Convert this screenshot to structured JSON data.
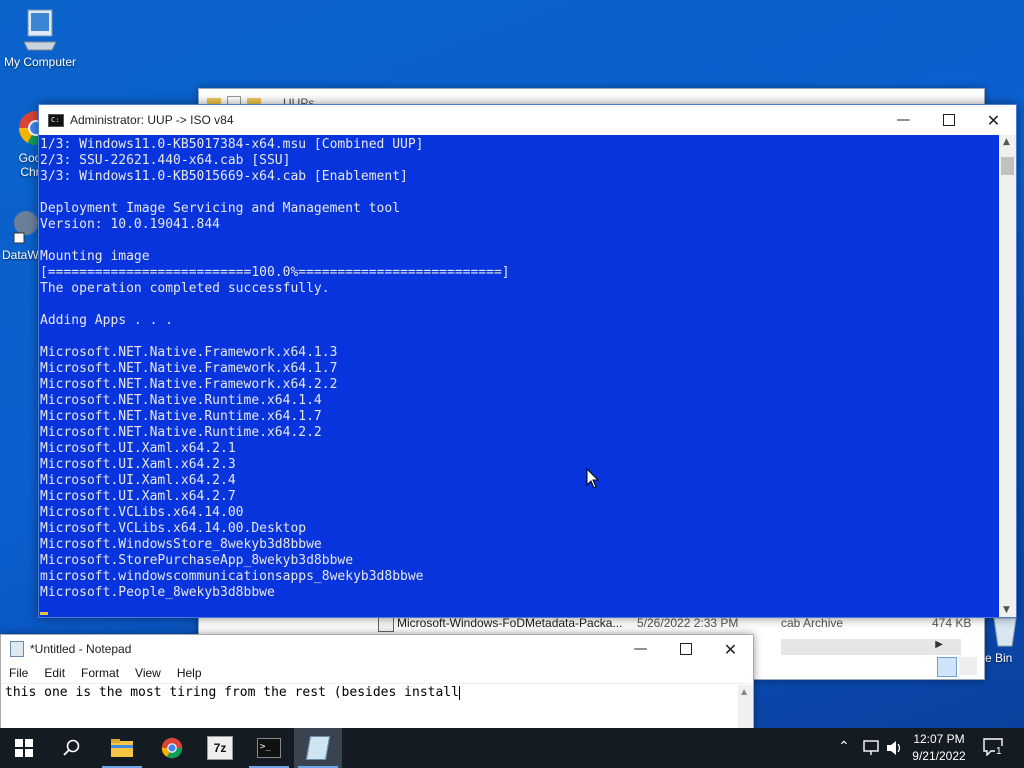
{
  "desktop": {
    "icons": [
      {
        "label": "My Computer"
      },
      {
        "label": "Goo\nChr"
      },
      {
        "label": "DataW"
      },
      {
        "label": "e Bin"
      }
    ]
  },
  "explorer": {
    "title": "UUPs",
    "file": {
      "name": "Microsoft-Windows-FoDMetadata-Packa...",
      "date": "5/26/2022 2:33 PM",
      "type": "cab Archive",
      "size": "474 KB"
    }
  },
  "cmd": {
    "title": "Administrator:  UUP -> ISO v84",
    "lines": [
      "1/3: Windows11.0-KB5017384-x64.msu [Combined UUP]",
      "2/3: SSU-22621.440-x64.cab [SSU]",
      "3/3: Windows11.0-KB5015669-x64.cab [Enablement]",
      "",
      "Deployment Image Servicing and Management tool",
      "Version: 10.0.19041.844",
      "",
      "Mounting image",
      "[==========================100.0%==========================]",
      "The operation completed successfully.",
      "",
      "Adding Apps . . .",
      "",
      "Microsoft.NET.Native.Framework.x64.1.3",
      "Microsoft.NET.Native.Framework.x64.1.7",
      "Microsoft.NET.Native.Framework.x64.2.2",
      "Microsoft.NET.Native.Runtime.x64.1.4",
      "Microsoft.NET.Native.Runtime.x64.1.7",
      "Microsoft.NET.Native.Runtime.x64.2.2",
      "Microsoft.UI.Xaml.x64.2.1",
      "Microsoft.UI.Xaml.x64.2.3",
      "Microsoft.UI.Xaml.x64.2.4",
      "Microsoft.UI.Xaml.x64.2.7",
      "Microsoft.VCLibs.x64.14.00",
      "Microsoft.VCLibs.x64.14.00.Desktop",
      "Microsoft.WindowsStore_8wekyb3d8bbwe",
      "Microsoft.StorePurchaseApp_8wekyb3d8bbwe",
      "microsoft.windowscommunicationsapps_8wekyb3d8bbwe",
      "Microsoft.People_8wekyb3d8bbwe"
    ]
  },
  "notepad": {
    "title": "*Untitled - Notepad",
    "menu": [
      "File",
      "Edit",
      "Format",
      "View",
      "Help"
    ],
    "text": "this one is the most tiring from the rest (besides install"
  },
  "taskbar": {
    "time": "12:07 PM",
    "date": "9/21/2022",
    "notification_count": "1"
  }
}
